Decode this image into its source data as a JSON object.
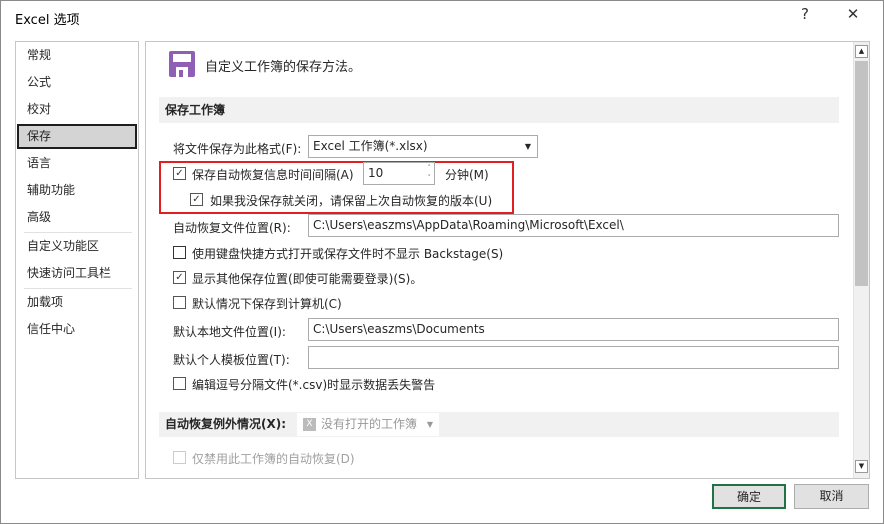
{
  "window": {
    "title": "Excel 选项",
    "help": "?",
    "close": "✕"
  },
  "sidebar": {
    "items": [
      "常规",
      "公式",
      "校对",
      "保存",
      "语言",
      "辅助功能",
      "高级",
      "自定义功能区",
      "快速访问工具栏",
      "加载项",
      "信任中心"
    ],
    "active": "保存"
  },
  "header": {
    "text": "自定义工作簿的保存方法。",
    "icon": "save-icon",
    "icon_color": "#8e5fb5"
  },
  "save_section": {
    "title": "保存工作簿",
    "format_label": "将文件保存为此格式(F):",
    "format_value": "Excel 工作簿(*.xlsx)",
    "autorecover_label": "保存自动恢复信息时间间隔(A)",
    "autorecover_checked": true,
    "interval_value": "10",
    "interval_unit": "分钟(M)",
    "keep_version_label": "如果我没保存就关闭，请保留上次自动恢复的版本(U)",
    "keep_version_checked": true,
    "autorecover_location_label": "自动恢复文件位置(R):",
    "autorecover_location_value": "C:\\Users\\easzms\\AppData\\Roaming\\Microsoft\\Excel\\",
    "backstage_label": "使用键盘快捷方式打开或保存文件时不显示 Backstage(S)",
    "backstage_checked": false,
    "show_other_label": "显示其他保存位置(即使可能需要登录)(S)。",
    "show_other_checked": true,
    "save_computer_label": "默认情况下保存到计算机(C)",
    "save_computer_checked": false,
    "local_path_label": "默认本地文件位置(I):",
    "local_path_value": "C:\\Users\\easzms\\Documents",
    "template_label": "默认个人模板位置(T):",
    "template_value": "",
    "csv_label": "编辑逗号分隔文件(*.csv)时显示数据丢失警告",
    "csv_checked": false
  },
  "exceptions": {
    "title": "自动恢复例外情况(X):",
    "workbook": "没有打开的工作簿",
    "disable_label": "仅禁用此工作簿的自动恢复(D)",
    "disable_checked": false
  },
  "buttons": {
    "ok": "确定",
    "cancel": "取消"
  },
  "highlight_color": "#e02020"
}
